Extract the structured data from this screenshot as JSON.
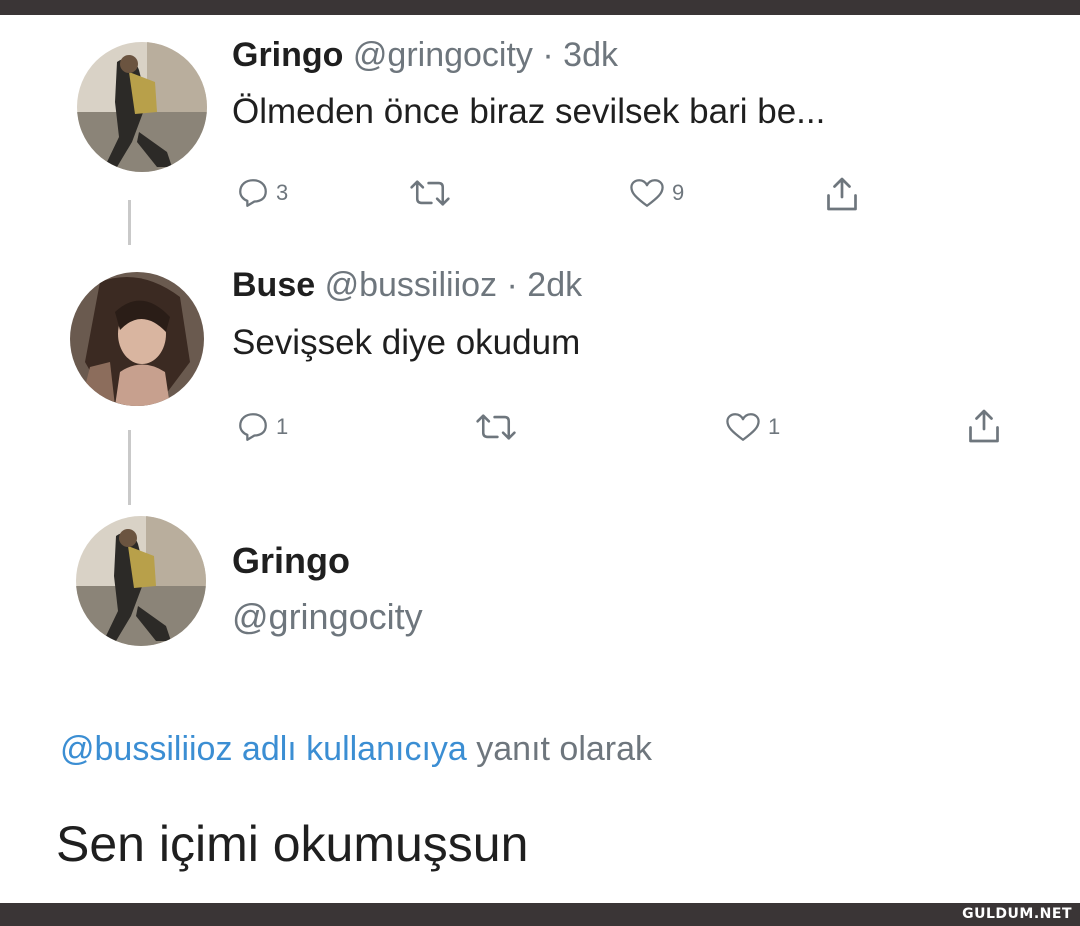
{
  "tweets": [
    {
      "name": "Gringo",
      "handle": "@gringocity",
      "time": "3dk",
      "text": "Ölmeden önce biraz sevilsek bari be...",
      "reply_count": "3",
      "like_count": "9"
    },
    {
      "name": "Buse",
      "handle": "@bussiliioz",
      "time": "2dk",
      "text": "Sevişsek diye okudum",
      "reply_count": "1",
      "like_count": "1"
    }
  ],
  "main_tweet": {
    "name": "Gringo",
    "handle": "@gringocity",
    "reply_mention": "@bussiliioz adlı kullanıcıya",
    "reply_suffix": "yanıt olarak",
    "text": "Sen içimi okumuşsun"
  },
  "separator": "·",
  "watermark": "GULDUM.NET",
  "colors": {
    "text": "#1f1f1f",
    "muted": "#6e767d",
    "link": "#3b8ed3",
    "frame": "#3a3536"
  },
  "icons": [
    "reply-icon",
    "retweet-icon",
    "like-icon",
    "share-icon"
  ]
}
